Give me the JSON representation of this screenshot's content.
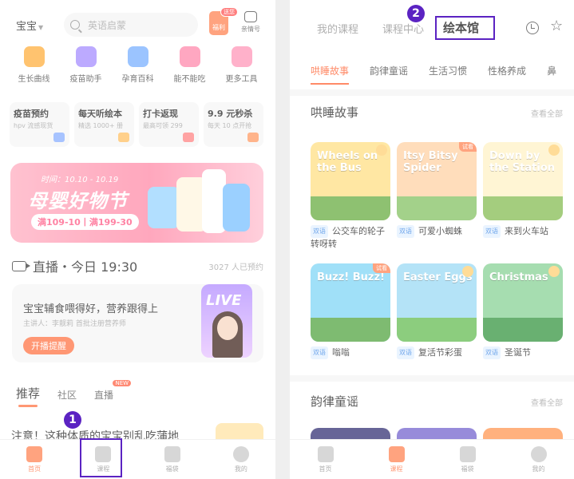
{
  "left": {
    "header": {
      "baby_label": "宝宝",
      "search_placeholder": "英语启蒙",
      "gift_tag": "送您",
      "gift_label": "福利",
      "fav_label": "亲情号"
    },
    "tools": [
      {
        "label": "生长曲线",
        "color": "#ffb347"
      },
      {
        "label": "疫苗助手",
        "color": "#a993ff"
      },
      {
        "label": "孕育百科",
        "color": "#7fb4ff"
      },
      {
        "label": "能不能吃",
        "color": "#ff8fb0"
      },
      {
        "label": "更多工具",
        "color": "#ff9cbc"
      }
    ],
    "cards": [
      {
        "title": "疫苗预约",
        "sub": "hpv 流感现货",
        "color": "#8fb3ff"
      },
      {
        "title": "每天听绘本",
        "sub": "精选 1000+ 册",
        "color": "#ffc36b"
      },
      {
        "title": "打卡返现",
        "sub": "最高可领 299",
        "color": "#ff8a8a"
      },
      {
        "title": "9.9 元秒杀",
        "sub": "每天 10 点开抢",
        "color": "#ff9f6b"
      }
    ],
    "banner": {
      "date": "时间：10.10 - 10.19",
      "title": "母婴好物节",
      "offer": "满109-10丨满199-30"
    },
    "live": {
      "title": "直播・今日 19:30",
      "count": "3027 人已预约",
      "card_title": "宝宝辅食喂得好，营养跟得上",
      "card_sub": "主讲人：李靓莉 首批注册营养师",
      "remind_button": "开播提醒",
      "badge": "LIVE"
    },
    "feed_tabs": [
      {
        "label": "推荐"
      },
      {
        "label": "社区"
      },
      {
        "label": "直播"
      }
    ],
    "feed_new": "NEW",
    "feed_title": "注意！这种体质的宝宝别乱吃蒲地",
    "tabbar": [
      {
        "label": "首页"
      },
      {
        "label": "课程"
      },
      {
        "label": "福袋"
      },
      {
        "label": "我的"
      }
    ]
  },
  "right": {
    "top_tabs": [
      {
        "label": "我的课程"
      },
      {
        "label": "课程中心"
      },
      {
        "label": "绘本馆"
      }
    ],
    "sub_tabs": [
      {
        "label": "哄睡故事"
      },
      {
        "label": "韵律童谣"
      },
      {
        "label": "生活习惯"
      },
      {
        "label": "性格养成"
      },
      {
        "label": "鼻"
      }
    ],
    "section1": {
      "title": "哄睡故事",
      "more": "查看全部"
    },
    "section2": {
      "title": "韵律童谣",
      "more": "查看全部"
    },
    "books": [
      {
        "tag": "双语",
        "title": "公交车的轮子转呀转",
        "cover_text": "Wheels on the Bus",
        "trial": "",
        "color": "#ffe08a"
      },
      {
        "tag": "双语",
        "title": "可爱小蜘蛛",
        "cover_text": "Itsy Bitsy Spider",
        "trial": "试看",
        "color": "#ffd4a8"
      },
      {
        "tag": "双语",
        "title": "来到火车站",
        "cover_text": "Down by the Station",
        "trial": "",
        "color": "#fff2c8"
      },
      {
        "tag": "双语",
        "title": "嗡嗡",
        "cover_text": "Buzz! Buzz!",
        "trial": "试看",
        "color": "#86d8f7"
      },
      {
        "tag": "双语",
        "title": "复活节彩蛋",
        "cover_text": "Easter Eggs",
        "trial": "",
        "color": "#9fdcf5"
      },
      {
        "tag": "双语",
        "title": "圣诞节",
        "cover_text": "Christmas",
        "trial": "",
        "color": "#8ed49a"
      }
    ],
    "tabbar": [
      {
        "label": "首页"
      },
      {
        "label": "课程"
      },
      {
        "label": "福袋"
      },
      {
        "label": "我的"
      }
    ]
  },
  "annotations": [
    {
      "label": "1"
    },
    {
      "label": "2"
    }
  ],
  "colors": {
    "accent": "#ff7a4d",
    "highlight": "#5b23c2"
  }
}
